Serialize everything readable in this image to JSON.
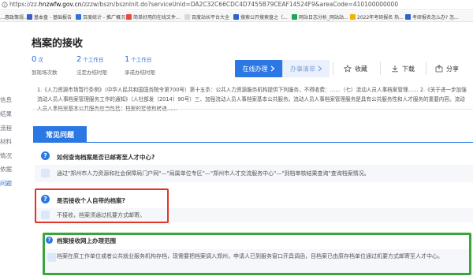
{
  "browser": {
    "url_prefix": "https://zz.",
    "url_host": "hnzwfw.gov.cn",
    "url_rest": "/zzzw/bszn/bsznInit.do?serviceUnid=DA2C32C66CDC4D7455B79CEAF14524F9&areaCode=410100000000",
    "bookmarks": [
      "…惠政策规…",
      "基本盘 - 基础报告",
      "百度统计 - 推广概况",
      "简单好用的在线文件...",
      "百度站长平台大全",
      "搜索公开搜索盘之（...",
      "网站日志分析_网站站...",
      "2022年考研报名 热...",
      "考研报名怎么办? 怎..."
    ]
  },
  "sidebar": {
    "items": [
      "信息",
      "结果",
      "流程",
      "材料",
      "情况",
      "依据",
      "问题"
    ]
  },
  "page": {
    "title": "档案的接收",
    "stats": [
      {
        "num": "0",
        "unit": "次",
        "label": "到现场次数"
      },
      {
        "num": "2",
        "unit": "个工作日",
        "label": "法定办结时限"
      },
      {
        "num": "1",
        "unit": "个工作日",
        "label": "承诺办结时限"
      }
    ],
    "actions": {
      "online": "在线办理",
      "list": "办事清单",
      "favorite": "收藏",
      "download": "下载",
      "share": "分享"
    },
    "description": "1.《人力资源市场暂行条例》（中华人民共和国国务院令第700号）第十五条：公共人力资源服务机构提供下列服务，不得收费：……（七）流动人员人事档案管理……  2.《关于进一步加强流动人员人事档案管理服务工作的通知》（人社部发〔2014〕90号）三、加强流动人员人事档案基本公共服务。流动人员人事档案管理服务是具有公共服务性和人才服务的重要内容。流动人员人事档案基本公共服务应当包括：档案的接收和转递……"
  },
  "faq": {
    "heading": "常见问题",
    "items": [
      {
        "q": "如何查询档案是否已邮寄至人才中心?",
        "a": "通过\"郑州市人力资源和社会保障局门户网\"—\"局属单位专区\"—\"郑州市人才交流服务中心\"—\"到档审核结果查询\"查询档案情况。"
      },
      {
        "q": "是否接收个人自带的档案?",
        "a": "不接收，档案须通过机要方式邮寄。"
      },
      {
        "q": "档案接收网上办理范围",
        "a": "档案在原工作单位或者公共就业服务机构存档，现需要把档案调入郑州，申请人已到服务窗口开具调函，目档案已由原存档单位通过机要方式邮寄至人才中心。"
      }
    ]
  },
  "colors": {
    "primary": "#2b77e3",
    "highlight_red": "#e5332a",
    "highlight_green": "#3aa53c"
  }
}
